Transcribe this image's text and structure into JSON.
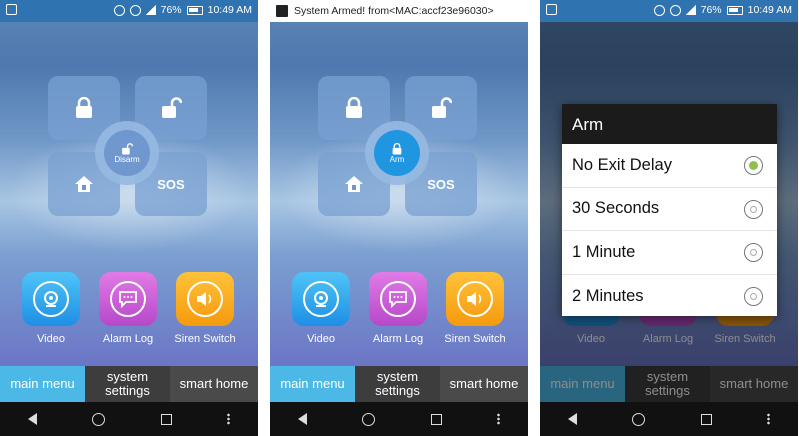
{
  "screens": [
    {
      "status_time": "10:49 AM",
      "status_battery": "76%",
      "center_label": "Disarm",
      "sos_label": "SOS",
      "apps": [
        "Video",
        "Alarm Log",
        "Siren Switch"
      ],
      "tabs": [
        "main menu",
        "system settings",
        "smart home"
      ]
    },
    {
      "notification": "System Armed! from<MAC:accf23e96030>",
      "center_label": "Arm",
      "sos_label": "SOS",
      "apps": [
        "Video",
        "Alarm Log",
        "Siren Switch"
      ],
      "tabs": [
        "main menu",
        "system settings",
        "smart home"
      ]
    },
    {
      "status_time": "10:49 AM",
      "status_battery": "76%",
      "apps": [
        "Video",
        "Alarm Log",
        "Siren Switch"
      ],
      "tabs": [
        "main menu",
        "system settings",
        "smart home"
      ],
      "dialog": {
        "title": "Arm",
        "options": [
          {
            "label": "No Exit Delay",
            "selected": true
          },
          {
            "label": "30 Seconds",
            "selected": false
          },
          {
            "label": "1 Minute",
            "selected": false
          },
          {
            "label": "2 Minutes",
            "selected": false
          }
        ]
      }
    }
  ],
  "colors": {
    "active_tab": "#4cb8e6",
    "armed_hub": "#2196e0",
    "radio_selected": "#8bc34a"
  }
}
